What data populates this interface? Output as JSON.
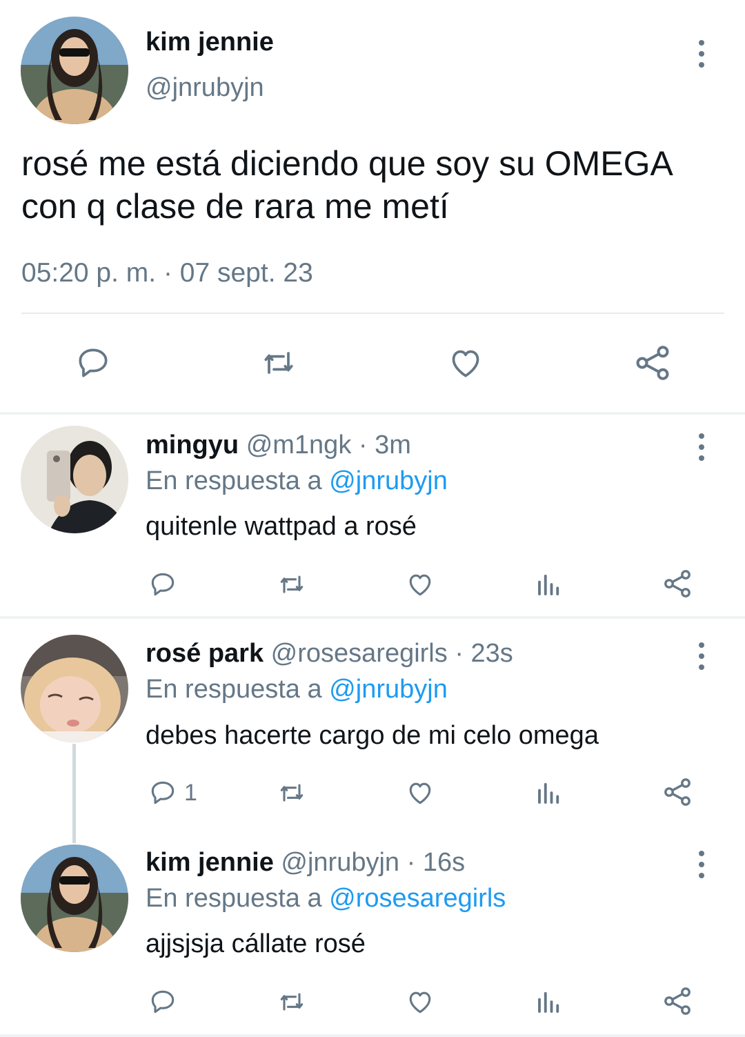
{
  "main_tweet": {
    "author_name": "kim jennie",
    "author_handle": "@jnrubyjn",
    "text": "rosé me está diciendo que soy su OMEGA con q clase de rara me metí",
    "timestamp": "05:20 p. m. · 07 sept. 23",
    "actions": [
      "reply-icon",
      "retweet-icon",
      "like-icon",
      "share-icon"
    ]
  },
  "replies": [
    {
      "author_name": "mingyu",
      "author_handle": "@m1ngk",
      "time": "· 3m",
      "reply_prefix": "En respuesta a",
      "reply_to": "@jnrubyjn",
      "text": "quitenle wattpad a rosé",
      "reply_count": ""
    },
    {
      "author_name": "rosé park",
      "author_handle": "@rosesaregirls",
      "time": "· 23s",
      "reply_prefix": "En respuesta a",
      "reply_to": "@jnrubyjn",
      "text": "debes hacerte cargo de mi celo omega",
      "reply_count": "1"
    },
    {
      "author_name": "kim jennie",
      "author_handle": "@jnrubyjn",
      "time": "· 16s",
      "reply_prefix": "En respuesta a",
      "reply_to": "@rosesaregirls",
      "text": "ajjsjsja cállate rosé",
      "reply_count": ""
    }
  ],
  "colors": {
    "text": "#0f1419",
    "secondary": "#657786",
    "mention": "#1d9bf0",
    "divider": "#e6ecf0"
  }
}
